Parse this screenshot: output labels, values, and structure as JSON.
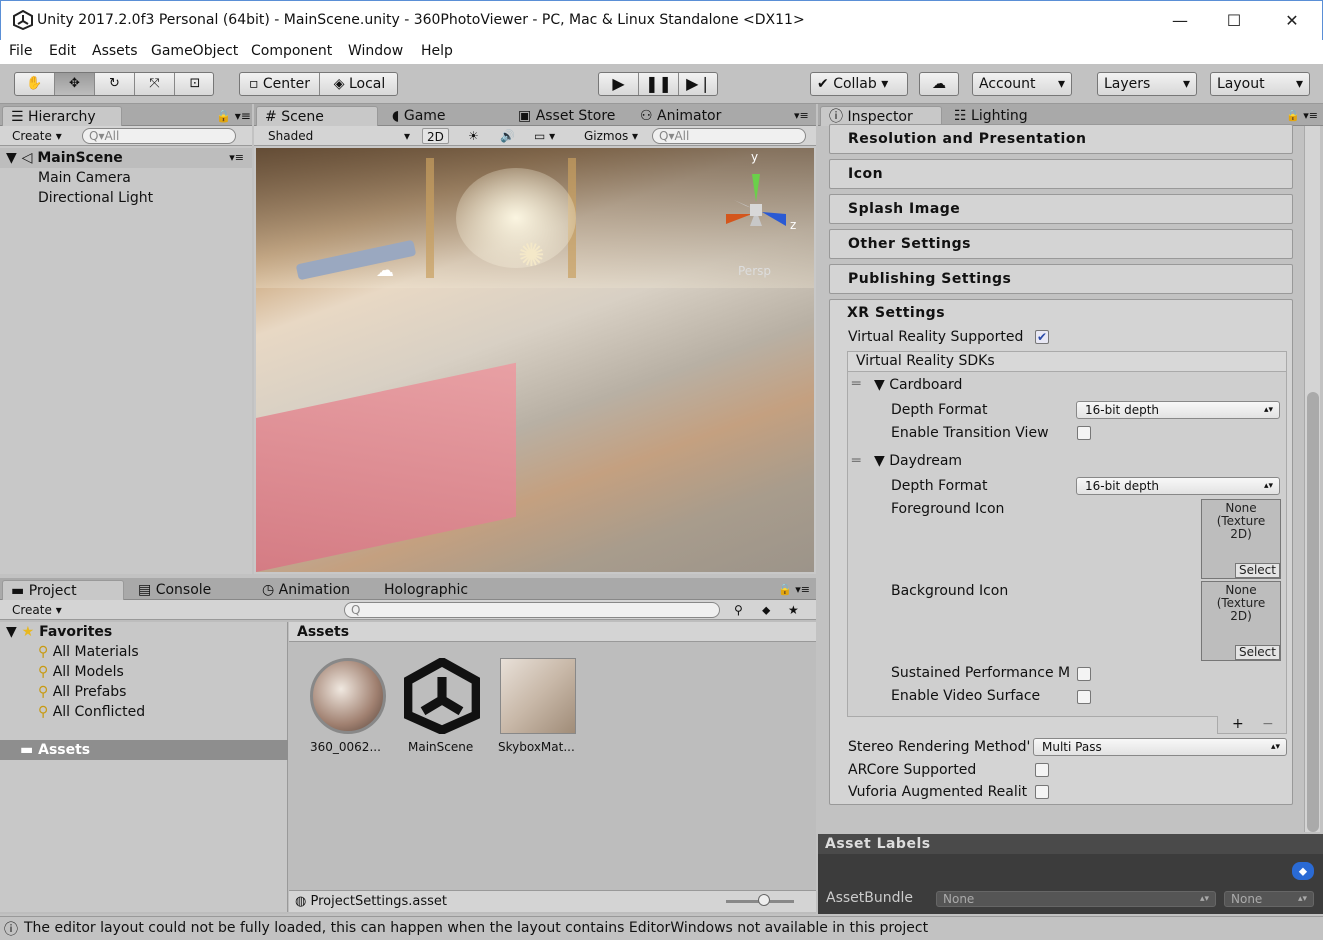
{
  "window": {
    "title": "Unity 2017.2.0f3 Personal (64bit) - MainScene.unity - 360PhotoViewer - PC, Mac & Linux Standalone <DX11>",
    "minimize": "—",
    "maximize": "☐",
    "close": "✕"
  },
  "menu": [
    "File",
    "Edit",
    "Assets",
    "GameObject",
    "Component",
    "Window",
    "Help"
  ],
  "toolbar": {
    "pivot_label": "Center",
    "space_label": "Local",
    "collab_label": "Collab",
    "account_label": "Account",
    "layers_label": "Layers",
    "layout_label": "Layout"
  },
  "hierarchy": {
    "tab": "Hierarchy",
    "create": "Create",
    "search_placeholder": "All",
    "scene": "MainScene",
    "items": [
      "Main Camera",
      "Directional Light"
    ]
  },
  "scene_tabs": {
    "scene": "Scene",
    "game": "Game",
    "asset_store": "Asset Store",
    "animator": "Animator"
  },
  "scene_toolbar": {
    "shading": "Shaded",
    "mode_2d": "2D",
    "gizmos": "Gizmos",
    "search_placeholder": "All",
    "persp": "Persp",
    "axis_y": "y",
    "axis_z": "z"
  },
  "project": {
    "tabs": {
      "project": "Project",
      "console": "Console",
      "animation": "Animation",
      "holographic": "Holographic"
    },
    "create": "Create",
    "favorites_label": "Favorites",
    "favorites": [
      "All Materials",
      "All Models",
      "All Prefabs",
      "All Conflicted"
    ],
    "assets_folder": "Assets",
    "assets_header": "Assets",
    "assets": [
      "360_0062...",
      "MainScene",
      "SkyboxMat..."
    ],
    "footer": "ProjectSettings.asset"
  },
  "inspector": {
    "tabs": {
      "inspector": "Inspector",
      "lighting": "Lighting"
    },
    "sections": [
      "Resolution and Presentation",
      "Icon",
      "Splash Image",
      "Other Settings",
      "Publishing Settings"
    ],
    "xr": {
      "title": "XR Settings",
      "vr_supported": "Virtual Reality Supported",
      "sdks_header": "Virtual Reality SDKs",
      "cardboard": "Cardboard",
      "daydream": "Daydream",
      "depth_format": "Depth Format",
      "depth_value": "16-bit depth",
      "enable_transition": "Enable Transition View",
      "foreground_icon": "Foreground Icon",
      "background_icon": "Background Icon",
      "texture_none": "None (Texture 2D)",
      "select": "Select",
      "sustained_perf": "Sustained Performance M",
      "video_surface": "Enable Video Surface",
      "plus": "+",
      "minus": "−",
      "stereo_method": "Stereo Rendering Method'",
      "stereo_value": "Multi Pass",
      "arcore": "ARCore Supported",
      "vuforia": "Vuforia Augmented Realit"
    },
    "asset_labels": "Asset Labels",
    "asset_bundle": "AssetBundle",
    "none": "None"
  },
  "status": "The editor layout could not be fully loaded, this can happen when the layout contains EditorWindows not available in this project"
}
